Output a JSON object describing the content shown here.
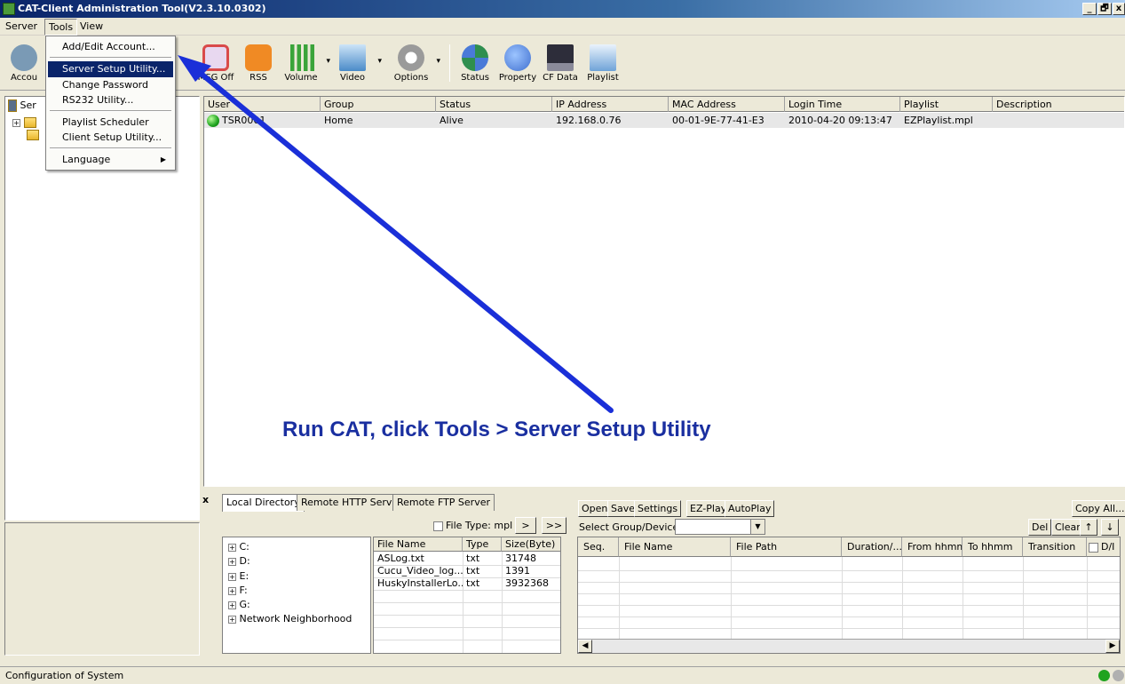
{
  "window": {
    "title": "CAT-Client Administration Tool(V2.3.10.0302)",
    "buttons": [
      "_",
      "🗗",
      "x"
    ]
  },
  "menubar": [
    "Server",
    "Tools",
    "View"
  ],
  "tools_menu": {
    "items": [
      "Add/Edit Account...",
      "Server Setup Utility...",
      "Change Password",
      "RS232 Utility...",
      "Playlist Scheduler",
      "Client Setup Utility...",
      "Language"
    ],
    "selected": "Server Setup Utility..."
  },
  "toolbar": {
    "items": [
      {
        "label": "Accou",
        "icon": "account-icon",
        "color": "#7a9ab5"
      },
      {
        "label": "MSG Off",
        "icon": "msg-off-icon",
        "color": "#d94a4a"
      },
      {
        "label": "RSS",
        "icon": "rss-icon",
        "color": "#f08a24"
      },
      {
        "label": "Volume",
        "icon": "volume-icon",
        "color": "#3aa43a"
      },
      {
        "label": "Video",
        "icon": "video-icon",
        "color": "#4a8ac8"
      },
      {
        "label": "Options",
        "icon": "options-icon",
        "color": "#9a9a9a"
      },
      {
        "label": "Status",
        "icon": "status-icon",
        "color": "#2f8f4f"
      },
      {
        "label": "Property",
        "icon": "property-icon",
        "color": "#3f6fcf"
      },
      {
        "label": "CF Data",
        "icon": "cf-data-icon",
        "color": "#2d2d3a"
      },
      {
        "label": "Playlist",
        "icon": "playlist-icon",
        "color": "#6fa3d8"
      }
    ]
  },
  "tree": {
    "root": "Ser"
  },
  "client_grid": {
    "columns": [
      "User",
      "Group",
      "Status",
      "IP Address",
      "MAC Address",
      "Login Time",
      "Playlist",
      "Description"
    ],
    "rows": [
      {
        "user": "TSR0001",
        "group": "Home",
        "status": "Alive",
        "ip": "192.168.0.76",
        "mac": "00-01-9E-77-41-E3",
        "login": "2010-04-20 09:13:47",
        "playlist": "EZPlaylist.mpl",
        "description": ""
      }
    ]
  },
  "annotation": "Run CAT, click Tools > Server Setup Utility",
  "bottom": {
    "close": "x",
    "tabs": [
      "Local Directory",
      "Remote HTTP Server",
      "Remote FTP Server"
    ],
    "file_type_label": "File Type: mpl",
    "nav_buttons": [
      ">",
      ">>"
    ],
    "drives": [
      "C:",
      "D:",
      "E:",
      "F:",
      "G:",
      "Network Neighborhood"
    ],
    "file_columns": [
      "File Name",
      "Type",
      "Size(Byte)"
    ],
    "files": [
      {
        "name": "ASLog.txt",
        "type": "txt",
        "size": "31748"
      },
      {
        "name": "Cucu_Video_log....",
        "type": "txt",
        "size": "1391"
      },
      {
        "name": "HuskyInstallerLo...",
        "type": "txt",
        "size": "3932368"
      }
    ],
    "playlist_buttons": [
      "Open",
      "Save",
      "Settings",
      "EZ-Play",
      "AutoPlay"
    ],
    "copy_all": "Copy All...",
    "select_group_label": "Select Group/Device",
    "edit_buttons": [
      "Del",
      "Clear",
      "↑",
      "↓"
    ],
    "playlist_columns": [
      "Seq.",
      "File Name",
      "File Path",
      "Duration/...",
      "From hhmm",
      "To hhmm",
      "Transition",
      "D/I"
    ]
  },
  "statusbar": {
    "text": "Configuration of System",
    "lights": [
      "#1fa31f",
      "#b0b0b0"
    ]
  }
}
